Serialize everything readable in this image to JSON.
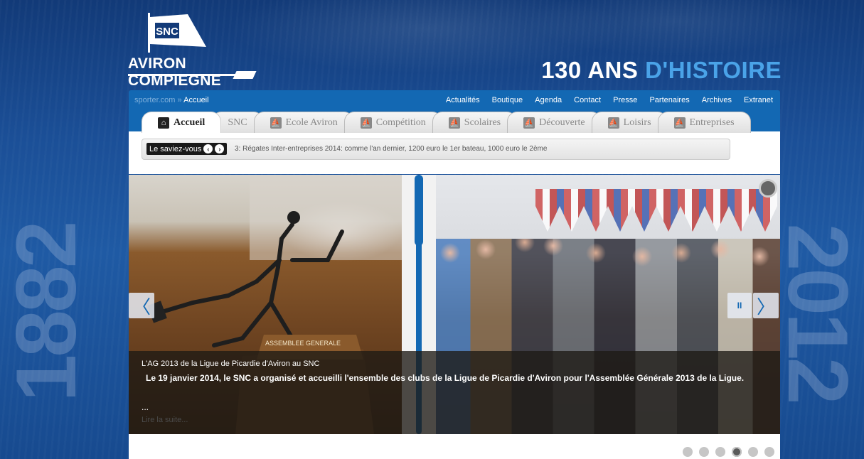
{
  "brand": {
    "logo_flag_text": "SNC",
    "logo_name": "AVIRON COMPIEGNE",
    "tagline_main": "130 ANS ",
    "tagline_highlight": "D'HISTOIRE",
    "year_left": "1882",
    "year_right": "2012",
    "accent": "#1368b3"
  },
  "breadcrumb": {
    "site": "sporter.com",
    "separator": "»",
    "current": "Accueil"
  },
  "top_nav": [
    "Actualités",
    "Boutique",
    "Agenda",
    "Contact",
    "Presse",
    "Partenaires",
    "Archives",
    "Extranet"
  ],
  "tabs": [
    {
      "label": "Accueil",
      "icon": "home-icon",
      "active": true
    },
    {
      "label": "SNC",
      "icon": "",
      "active": false
    },
    {
      "label": "Ecole Aviron",
      "icon": "rowing-icon",
      "active": false
    },
    {
      "label": "Compétition",
      "icon": "rowing-icon",
      "active": false
    },
    {
      "label": "Scolaires",
      "icon": "rowing-icon",
      "active": false
    },
    {
      "label": "Découverte",
      "icon": "rowing-icon",
      "active": false
    },
    {
      "label": "Loisirs",
      "icon": "rowing-icon",
      "active": false
    },
    {
      "label": "Entreprises",
      "icon": "rowing-icon",
      "active": false
    }
  ],
  "ticker": {
    "label": "Le saviez-vous",
    "text": "3: Régates Inter-entreprises 2014: comme l'an dernier, 1200 euro le 1er bateau, 1000 euro le 2ème"
  },
  "slide": {
    "title": "L'AG 2013 de la Ligue de Picardie d'Aviron au SNC",
    "body": "Le 19 janvier 2014, le SNC a organisé et accueilli l'ensemble des clubs de la Ligue de Picardie d'Aviron pour l'Assemblée Générale 2013 de la Ligue.",
    "ellipsis": "...",
    "read_more": "Lire la suite...",
    "plaque_text": "ASSEMBLEE GENERALE"
  },
  "slider_controls": {
    "prev": "〈",
    "next": "〉",
    "pause": "II",
    "dots_count": 6,
    "active_dot": 4
  }
}
